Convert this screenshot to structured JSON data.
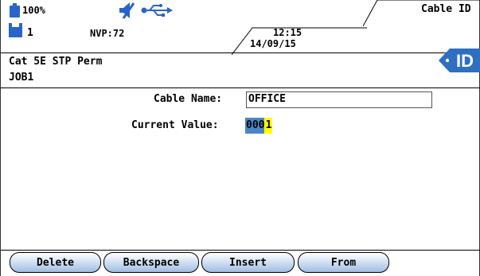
{
  "status": {
    "battery": "100%",
    "job_number": "1",
    "nvp": "NVP:72",
    "time": "12:15",
    "date": "14/09/15"
  },
  "header": {
    "title": "Cable ID",
    "cable_type": "Cat 5E STP Perm",
    "job_name": "JOB1",
    "badge": "ID"
  },
  "form": {
    "cable_name_label": "Cable Name:",
    "cable_name_value": "OFFICE",
    "current_value_label": "Current Value:",
    "current_value_selected": "000",
    "current_value_cursor": "1"
  },
  "softkeys": [
    {
      "label": "Delete"
    },
    {
      "label": "Backspace"
    },
    {
      "label": "Insert"
    },
    {
      "label": "From"
    }
  ],
  "colors": {
    "selection": "#4a86c6",
    "cursor": "#ffff00",
    "softkey_gradient_end": "#9fbde3",
    "badge": "#2e6fc0"
  },
  "icons": [
    "battery-icon",
    "speaker-muted-icon",
    "usb-icon",
    "memory-card-icon",
    "id-badge-icon"
  ]
}
